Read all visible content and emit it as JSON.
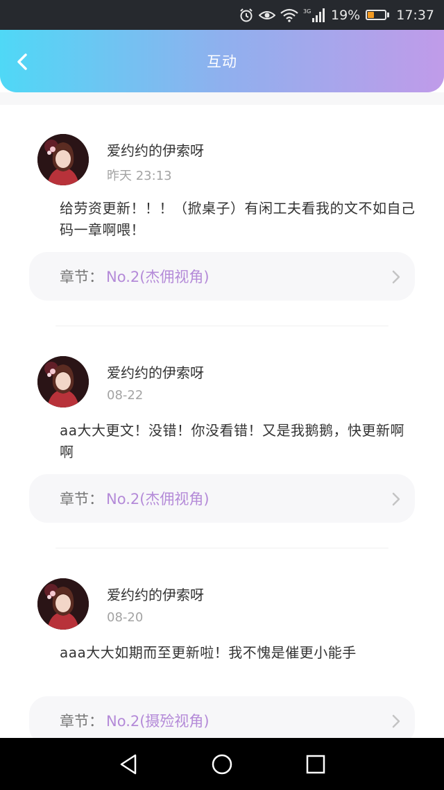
{
  "status_bar": {
    "network": "3G",
    "battery": "19%",
    "time": "17:37",
    "icons": [
      "alarm-icon",
      "eye-icon",
      "wifi-icon",
      "signal-icon",
      "battery-icon"
    ]
  },
  "header": {
    "title": "互动",
    "back_icon": "chevron-left-icon"
  },
  "comments": [
    {
      "username": "爱约约的伊索呀",
      "time": "昨天 23:13",
      "text": "给劳资更新！！！（掀桌子）有闲工夫看我的文不如自己码一章啊喂！",
      "chapter_prefix": "章节：",
      "chapter_name": "No.2(杰佣视角)"
    },
    {
      "username": "爱约约的伊索呀",
      "time": "08-22",
      "text": "aa大大更文！没错！你没看错！又是我鹅鹅，快更新啊啊",
      "chapter_prefix": "章节：",
      "chapter_name": "No.2(杰佣视角)"
    },
    {
      "username": "爱约约的伊索呀",
      "time": "08-20",
      "text": "aaa大大如期而至更新啦！我不愧是催更小能手",
      "chapter_prefix": "章节：",
      "chapter_name": "No.2(摄殓视角)"
    }
  ],
  "nav_bar": {
    "icons": [
      "back-triangle-icon",
      "home-circle-icon",
      "recents-square-icon"
    ]
  },
  "colors": {
    "header_gradient": [
      "#4fd8f6",
      "#8fb0ee",
      "#c09be9"
    ],
    "chapter_accent": "#b48ad8",
    "battery_fill": "#f29a22"
  }
}
